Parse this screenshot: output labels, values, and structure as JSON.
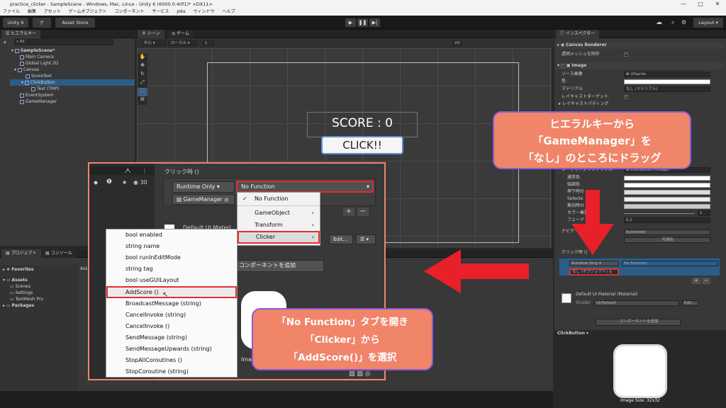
{
  "window": {
    "title": "practice_clicker - SampleScene - Windows, Mac, Linux - Unity 6 (6000.0.40f1)* <DX11>",
    "minimize": "—",
    "maximize": "□",
    "close": "✕"
  },
  "menubar": [
    "ファイル",
    "編集",
    "アセット",
    "ゲームオブジェクト",
    "コンポーネント",
    "サービス",
    "Jobs",
    "ウィンドウ",
    "ヘルプ"
  ],
  "toolbar": {
    "unity_label": "Unity 6",
    "account": "ナ",
    "asset_store": "Asset Store",
    "layout": "Layout"
  },
  "hierarchy": {
    "tab": "ヒエラルキー",
    "search_placeholder": "All",
    "items": [
      {
        "label": "SampleScene*",
        "indent": 0
      },
      {
        "label": "Main Camera",
        "indent": 2
      },
      {
        "label": "Global Light 2D",
        "indent": 2
      },
      {
        "label": "Canvas",
        "indent": 2
      },
      {
        "label": "ScoreText",
        "indent": 3
      },
      {
        "label": "ClickButton",
        "indent": 3
      },
      {
        "label": "Text (TMP)",
        "indent": 4
      },
      {
        "label": "EventSystem",
        "indent": 2
      },
      {
        "label": "GameManager",
        "indent": 2
      }
    ]
  },
  "scene": {
    "tab_scene": "シーン",
    "tab_game": "ゲーム",
    "pivot": "中心",
    "space": "ローカル",
    "snap": "1",
    "mode_2d": "2D",
    "score_text": "SCORE : 0",
    "button_text": "CLICK!!"
  },
  "project": {
    "tab_project": "プロジェクト",
    "tab_console": "コンソール",
    "favorites": "Favorites",
    "assets": "Assets",
    "folders": [
      "Scenes",
      "Settings",
      "TextMesh Pro"
    ],
    "packages": "Packages",
    "assets_header": "Ass"
  },
  "inspector": {
    "tab": "インスペクター",
    "canvas_renderer": "Canvas Renderer",
    "cull_transparent": "透明メッシュを除外",
    "image": "Image",
    "source_image_label": "ソース画像",
    "source_image_value": "UISprite",
    "color_label": "色",
    "material_label": "マテリアル",
    "material_value": "なし (マテリアル)",
    "raycast_target": "レイキャストターゲット",
    "raycast_padding": "レイキャストパディング",
    "target_graphic_label": "ターゲットグラフィックス",
    "target_graphic_value": "ClickButton (Image)",
    "normal_color": "通常色",
    "highlight_color": "強調色",
    "pressed_color": "押下時の",
    "selected_color": "Selecte",
    "disabled_color": "無効時の",
    "color_mult": "カラー乗算",
    "color_mult_value": "1",
    "fade_duration": "フェード",
    "fade_value": "0.1",
    "navigation": "ナビゲー",
    "navigation_value": "Automatic",
    "visualize": "可視化",
    "onclick": "クリック時 ()",
    "runtime_only": "Runtime Only",
    "no_function": "No Function",
    "none_object": "なし (オブジェクト)",
    "default_material": "Default UI Material (Material)",
    "shader_label": "Shader",
    "shader_value": "UI/Default",
    "edit": "Edit...",
    "add_component": "コンポーネントを追加",
    "preview_title": "ClickButton",
    "preview_label": "ClickButton",
    "preview_size": "Image Size: 32x32"
  },
  "zoom": {
    "onclick": "クリック時 ()",
    "runtime_only": "Runtime Only",
    "no_function": "No Function",
    "object_field": "GameManager",
    "count": "30",
    "default_material": "Default UI Materi",
    "edit": "Edit...",
    "add_component": "コンポーネントを追加",
    "plus": "+",
    "minus": "−",
    "function_menu": [
      {
        "label": "No Function",
        "checked": true
      },
      {
        "label": "GameObject",
        "arrow": true
      },
      {
        "label": "Transform",
        "arrow": true
      },
      {
        "label": "Clicker",
        "arrow": true,
        "highlighted": true
      }
    ],
    "method_menu": [
      "bool enabled",
      "string name",
      "bool runInEditMode",
      "string tag",
      "bool useGUILayout",
      "AddScore ()",
      "BroadcastMessage (string)",
      "CancelInvoke (string)",
      "CancelInvoke ()",
      "SendMessage (string)",
      "SendMessageUpwards (string)",
      "StopAllCoroutines ()",
      "StopCoroutine (string)"
    ],
    "selected_method": "AddScore ()",
    "image_caption": "Ima"
  },
  "callouts": {
    "top": [
      "ヒエラルキーから",
      "「GameManager」を",
      "「なし」のところにドラッグ"
    ],
    "bottom": [
      "「No Function」タブを開き",
      "「Clicker」から",
      "「AddScore()」を選択"
    ]
  },
  "colors": {
    "callout_fill": "#f0856a",
    "callout_border": "#8a5bd6",
    "arrow": "#e8202a",
    "highlight_box": "#e03030",
    "selection_blue": "#2c5d87"
  }
}
